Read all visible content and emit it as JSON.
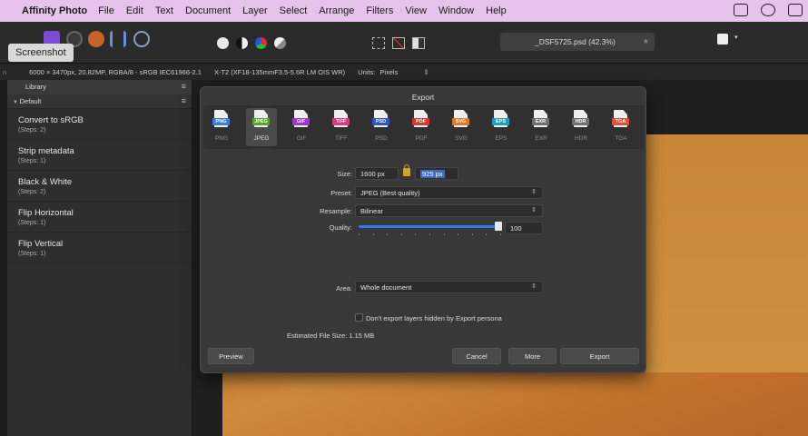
{
  "menubar": {
    "app_name": "Affinity Photo",
    "items": [
      "File",
      "Edit",
      "Text",
      "Document",
      "Layer",
      "Select",
      "Arrange",
      "Filters",
      "View",
      "Window",
      "Help"
    ]
  },
  "toolbar": {
    "tooltip": "Screenshot",
    "document_tab": "_DSF5725.psd (42.3%)"
  },
  "contextbar": {
    "doc_info": "6000 × 3470px, 20.82MP, RGBA/8 - sRGB IEC61966-2.1",
    "camera": "X-T2 (XF18-135mmF3.5-5.6R LM OIS WR)",
    "units_label": "Units:",
    "units_value": "Pixels"
  },
  "library": {
    "tab_label": "Library",
    "category": "Default",
    "macros": [
      {
        "name": "Convert to sRGB",
        "steps": "(Steps: 2)"
      },
      {
        "name": "Strip metadata",
        "steps": "(Steps: 1)"
      },
      {
        "name": "Black & White",
        "steps": "(Steps: 2)"
      },
      {
        "name": "Flip Horizontal",
        "steps": "(Steps: 1)"
      },
      {
        "name": "Flip Vertical",
        "steps": "(Steps: 1)"
      }
    ]
  },
  "export_dialog": {
    "title": "Export",
    "formats": [
      {
        "icon_text": "PNG",
        "label": "PNG",
        "color": "#3b7ddd"
      },
      {
        "icon_text": "JPEG",
        "label": "JPEG",
        "color": "#55a330",
        "selected": true
      },
      {
        "icon_text": "GIF",
        "label": "GIF",
        "color": "#9b3bbf"
      },
      {
        "icon_text": "TIFF",
        "label": "TIFF",
        "color": "#d83a7c"
      },
      {
        "icon_text": "PSD",
        "label": "PSD",
        "color": "#2f56c8"
      },
      {
        "icon_text": "PDF",
        "label": "PDF",
        "color": "#d33a2c"
      },
      {
        "icon_text": "SVG",
        "label": "SVG",
        "color": "#e07a1f"
      },
      {
        "icon_text": "EPS",
        "label": "EPS",
        "color": "#1aa3b7"
      },
      {
        "icon_text": "EXR",
        "label": "EXR",
        "color": "#6f6f6f"
      },
      {
        "icon_text": "HDR",
        "label": "HDR",
        "color": "#6f6f6f"
      },
      {
        "icon_text": "TGA",
        "label": "TGA",
        "color": "#e0533a"
      }
    ],
    "size_label": "Size:",
    "width": "1600 px",
    "height": "925 px",
    "preset_label": "Preset:",
    "preset_value": "JPEG (Best quality)",
    "resample_label": "Resample:",
    "resample_value": "Bilinear",
    "quality_label": "Quality:",
    "quality_value": "100",
    "area_label": "Area:",
    "area_value": "Whole document",
    "checkbox_label": "Don't export layers hidden by Export persona",
    "estimated_size": "Estimated File Size: 1.15 MB",
    "buttons": {
      "preview": "Preview",
      "cancel": "Cancel",
      "more": "More",
      "export": "Export"
    }
  }
}
